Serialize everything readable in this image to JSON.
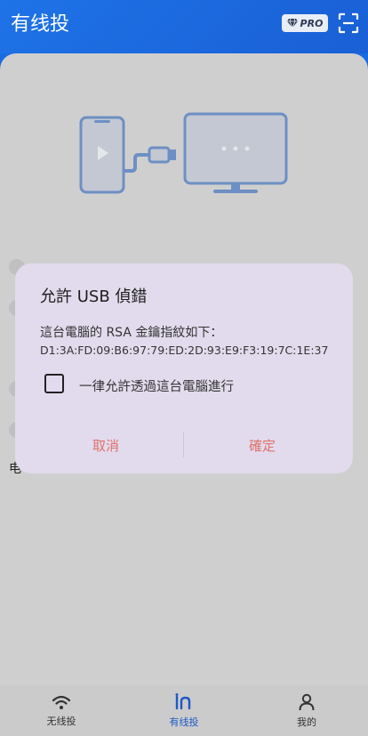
{
  "header": {
    "title": "有线投",
    "pro_badge": "PRO"
  },
  "dialog": {
    "title": "允許 USB 偵錯",
    "message": "這台電腦的 RSA 金鑰指紋如下：",
    "fingerprint": "D1:3A:FD:09:B6:97:79:ED:2D:93:E9:F3:19:7C:1E:37",
    "checkbox_label": "一律允許透過這台電腦進行",
    "checkbox_checked": false,
    "cancel_label": "取消",
    "ok_label": "確定"
  },
  "background": {
    "partial_text": "电"
  },
  "tabs": [
    {
      "label": "无线投",
      "icon": "wifi-icon"
    },
    {
      "label": "有线投",
      "icon": "cable-cast-icon",
      "active": true
    },
    {
      "label": "我的",
      "icon": "person-icon"
    }
  ],
  "colors": {
    "accent": "#1c58c9",
    "dialog_bg": "#e2dbed",
    "button_text": "#e0716c"
  }
}
